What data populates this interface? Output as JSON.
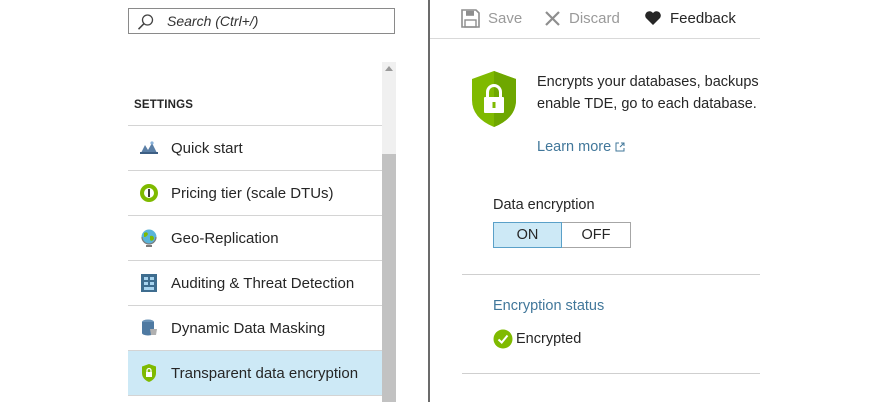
{
  "search": {
    "placeholder": "Search (Ctrl+/)",
    "icon": "search-icon"
  },
  "menu": {
    "section_title": "SETTINGS",
    "items": [
      {
        "label": "Quick start",
        "icon": "quick-start-icon"
      },
      {
        "label": "Pricing tier (scale DTUs)",
        "icon": "pricing-tier-icon"
      },
      {
        "label": "Geo-Replication",
        "icon": "globe-icon"
      },
      {
        "label": "Auditing & Threat Detection",
        "icon": "auditing-icon"
      },
      {
        "label": "Dynamic Data Masking",
        "icon": "data-masking-icon"
      },
      {
        "label": "Transparent data encryption",
        "icon": "shield-lock-icon",
        "active": true
      }
    ]
  },
  "toolbar": {
    "save_label": "Save",
    "discard_label": "Discard",
    "feedback_label": "Feedback"
  },
  "content": {
    "description_line1": "Encrypts your databases, backups",
    "description_line2": "enable TDE, go to each database.",
    "learn_more": "Learn more",
    "data_encryption_label": "Data encryption",
    "toggle_on": "ON",
    "toggle_off": "OFF",
    "toggle_selected": "ON",
    "encryption_status_label": "Encryption status",
    "encryption_status_value": "Encrypted"
  },
  "colors": {
    "accent_green": "#7fba00",
    "selected_bg": "#cde9f6",
    "link_blue": "#41779a"
  }
}
